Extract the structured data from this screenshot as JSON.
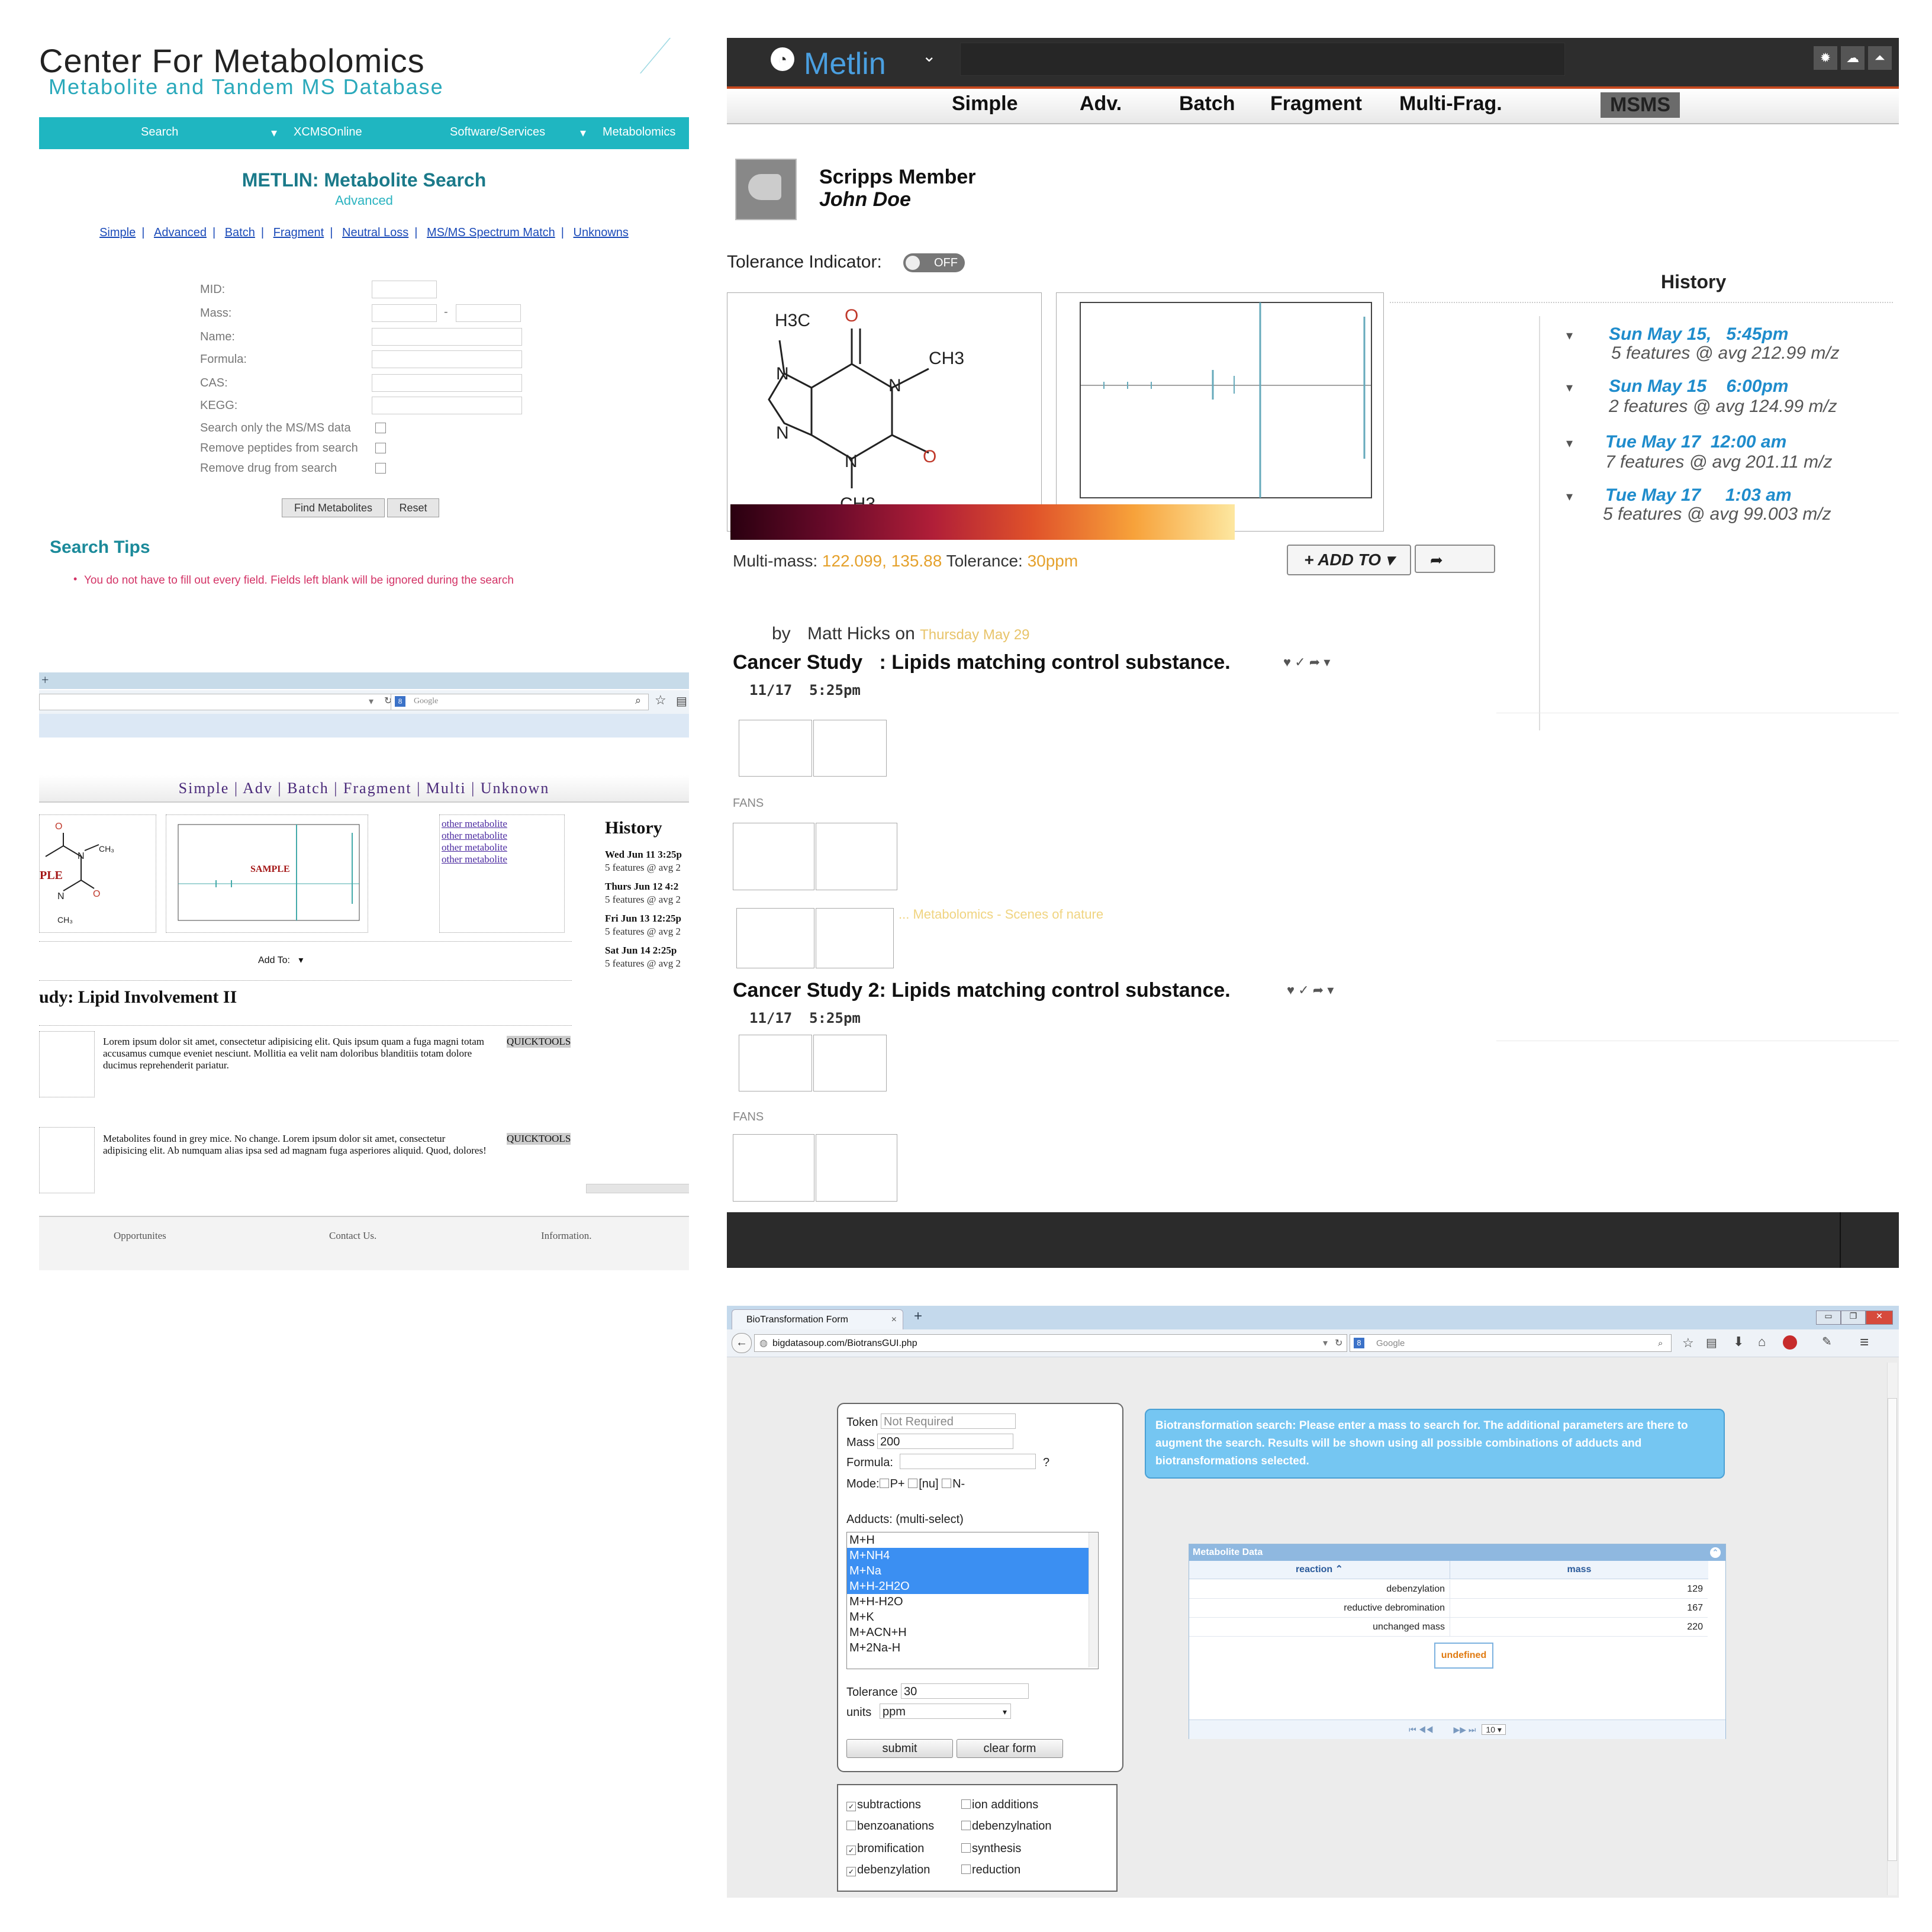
{
  "metabolomics": {
    "brand": "Center For Metabolomics",
    "subtitle": "Metabolite and Tandem MS Database",
    "nav": [
      "Search",
      "XCMSOnline",
      "Software/Services",
      "Metabolomics"
    ],
    "title": "METLIN: Metabolite Search",
    "mode": "Advanced",
    "links": [
      "Simple",
      "Advanced",
      "Batch",
      "Fragment",
      "Neutral Loss",
      "MS/MS Spectrum Match",
      "Unknowns"
    ],
    "fields": [
      "MID:",
      "Mass:",
      "Name:",
      "Formula:",
      "CAS:",
      "KEGG:"
    ],
    "mass_dash": "-",
    "checks": [
      "Search only the MS/MS data",
      "Remove peptides from search",
      "Remove drug from search"
    ],
    "find_button": "Find Metabolites",
    "reset_button": "Reset",
    "tips_title": "Search Tips",
    "tip": "You do not have to fill out every field. Fields left blank will be ignored during the search"
  },
  "browser": {
    "search_placeholder": "Google",
    "tabs_line": "Simple | Adv | Batch | Fragment | Multi | Unknown",
    "sample_label": "SAMPLE",
    "sample_partial": "PLE",
    "other_metabolite": [
      "other metabolite",
      "other metabolite",
      "other metabolite",
      "other metabolite"
    ],
    "history_title": "History",
    "history": [
      {
        "date": "Wed Jun 11 3:25p",
        "summary": "5 features @ avg 2"
      },
      {
        "date": "Thurs Jun 12 4:2",
        "summary": "5 features @ avg 2"
      },
      {
        "date": "Fri Jun 13 12:25p",
        "summary": "5 features @ avg 2"
      },
      {
        "date": "Sat Jun 14 2:25p",
        "summary": "5 features @ avg 2"
      }
    ],
    "add_to": "Add To:",
    "study_title": "udy: Lipid Involvement II",
    "posts": [
      {
        "text": "Lorem ipsum dolor sit amet, consectetur adipisicing elit. Quis ipsum quam a fuga magni totam accusamus cumque eveniet nesciunt. Mollitia ea velit nam doloribus blanditiis totam dolore ducimus reprehenderit pariatur.",
        "tool": "QUICKTOOLS"
      },
      {
        "text": "Metabolites found in grey mice. No change. Lorem ipsum dolor sit amet, consectetur adipisicing elit. Ab numquam alias ipsa sed ad magnam fuga asperiores aliquid. Quod, dolores!",
        "tool": "QUICKTOOLS"
      }
    ],
    "footer": [
      "Opportunites",
      "Contact Us.",
      "Information."
    ]
  },
  "metlin": {
    "logo": "Metlin",
    "tabs": [
      "Simple",
      "Adv.",
      "Batch",
      "Fragment",
      "Multi-Frag.",
      "MSMS"
    ],
    "member": "Scripps Member",
    "user": "John Doe",
    "tolerance_indicator": "Tolerance Indicator:",
    "toggle": "OFF",
    "history_title": "History",
    "history": [
      {
        "date": "Sun May 15,   5:45pm",
        "summary": "5 features @ avg 212.99 m/z"
      },
      {
        "date": "Sun May 15    6:00pm",
        "summary": "2 features @ avg 124.99 m/z"
      },
      {
        "date": "Tue May 17  12:00 am",
        "summary": "7 features @ avg 201.11 m/z"
      },
      {
        "date": "Tue May 17     1:03 am",
        "summary": "5 features @ avg 99.003 m/z"
      }
    ],
    "multimass_label": "Multi-mass:",
    "multimass_value": "122.099, 135.88",
    "tolerance_label": "Tolerance:",
    "tolerance_value": "30ppm",
    "add_to": "+ ADD TO",
    "byline_by": "by",
    "byline_author": "Matt Hicks",
    "byline_on": "on",
    "byline_date": "Thursday May 29",
    "posts": [
      {
        "title": "Cancer Study   : Lipids matching control substance.",
        "time": "11/17  5:25pm"
      },
      {
        "title": "Cancer Study 2: Lipids matching control substance.",
        "time": "11/17  5:25pm"
      }
    ],
    "fans": "FANS",
    "faint_text": "... Metabolomics - Scenes of nature",
    "molecule": {
      "h3c": "H3C",
      "ch3a": "CH3",
      "ch3b": "CH3",
      "o1": "O",
      "o2": "O",
      "n": "N"
    }
  },
  "biotrans": {
    "tab_title": "BioTransformation Form",
    "url": "bigdatasoup.com/BiotransGUI.php",
    "search_placeholder": "Google",
    "token_label": "Token",
    "token_value": "Not Required",
    "mass_label": "Mass",
    "mass_value": "200",
    "formula_label": "Formula:",
    "formula_q": "?",
    "mode_label": "Mode:",
    "modes": [
      "P+",
      "[nu]",
      "N-"
    ],
    "adducts_label": "Adducts: (multi-select)",
    "adducts": [
      {
        "name": "M+H",
        "selected": false
      },
      {
        "name": "M+NH4",
        "selected": true
      },
      {
        "name": "M+Na",
        "selected": true
      },
      {
        "name": "M+H-2H2O",
        "selected": true
      },
      {
        "name": "M+H-H2O",
        "selected": false
      },
      {
        "name": "M+K",
        "selected": false
      },
      {
        "name": "M+ACN+H",
        "selected": false
      },
      {
        "name": "M+2Na-H",
        "selected": false
      }
    ],
    "tolerance_label": "Tolerance",
    "tolerance_value": "30",
    "units_label": "units",
    "units_value": "ppm",
    "submit": "submit",
    "clear": "clear form",
    "checks": [
      {
        "label": "subtractions",
        "checked": true
      },
      {
        "label": "ion additions",
        "checked": false
      },
      {
        "label": "benzoanations",
        "checked": false
      },
      {
        "label": "debenzylnation",
        "checked": false
      },
      {
        "label": "bromification",
        "checked": true
      },
      {
        "label": "synthesis",
        "checked": false
      },
      {
        "label": "debenzylation",
        "checked": true
      },
      {
        "label": "reduction",
        "checked": false
      }
    ],
    "info": "Biotransformation search: Please enter a mass to search for. The additional parameters are there to augment the search. Results will be shown using all possible combinations of adducts and biotransformations selected.",
    "grid_title": "Metabolite Data",
    "columns": [
      "reaction",
      "mass"
    ],
    "rows": [
      {
        "reaction": "debenzylation",
        "mass": "129"
      },
      {
        "reaction": "reductive debromination",
        "mass": "167"
      },
      {
        "reaction": "unchanged mass",
        "mass": "220"
      }
    ],
    "undefined": "undefined",
    "page_size": "10"
  }
}
